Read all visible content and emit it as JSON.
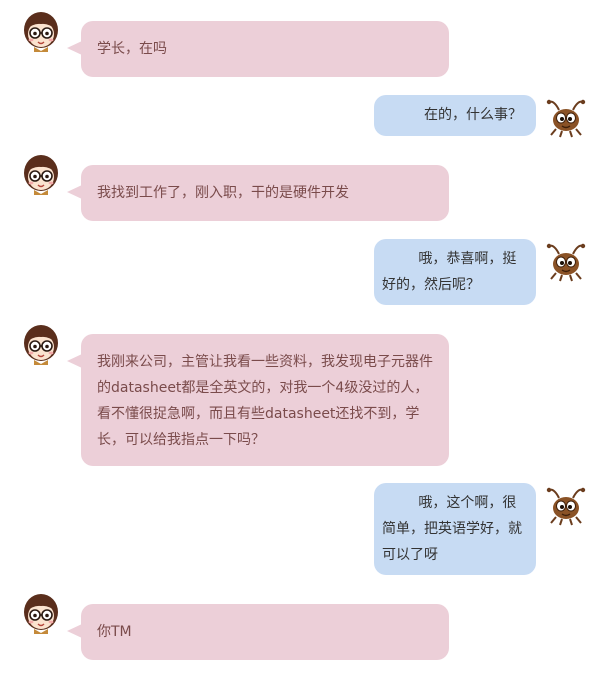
{
  "messages": [
    {
      "sender": "girl",
      "text": "学长，在吗"
    },
    {
      "sender": "ant",
      "text": "在的，什么事？"
    },
    {
      "sender": "girl",
      "text": "我找到工作了，刚入职，干的是硬件开发"
    },
    {
      "sender": "ant",
      "text": "哦，恭喜啊，挺好的，然后呢？"
    },
    {
      "sender": "girl",
      "text": "我刚来公司，主管让我看一些资料，我发现电子元器件的datasheet都是全英文的，对我一个4级没过的人，看不懂很捉急啊，而且有些datasheet还找不到，学长，可以给我指点一下吗？"
    },
    {
      "sender": "ant",
      "text": "哦，这个啊，很简单，把英语学好，就可以了呀"
    },
    {
      "sender": "girl",
      "text": "你TM"
    }
  ],
  "avatars": {
    "girl": "girl-with-glasses-avatar",
    "ant": "cartoon-ant-avatar"
  },
  "colors": {
    "girl_bubble": "#eccfd8",
    "ant_bubble": "#c7dbf3",
    "girl_text": "#7a4b4b",
    "ant_text": "#333333"
  }
}
